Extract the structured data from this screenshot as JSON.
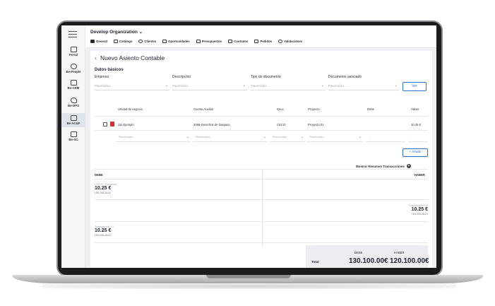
{
  "sidebar": {
    "items": [
      {
        "label": "Portal"
      },
      {
        "label": "Be-People"
      },
      {
        "label": "Be-CRM"
      },
      {
        "label": "Be-OPS"
      },
      {
        "label": "Be-AC&F"
      },
      {
        "label": "Be-SC"
      }
    ]
  },
  "header": {
    "org": "Develop Organization",
    "tabs": [
      {
        "label": "General"
      },
      {
        "label": "Catálogo"
      },
      {
        "label": "Clientes"
      },
      {
        "label": "Oportunidades"
      },
      {
        "label": "Presupuestos"
      },
      {
        "label": "Contratos"
      },
      {
        "label": "Pedidos"
      },
      {
        "label": "Validaciones"
      }
    ]
  },
  "page": {
    "title": "Nuevo Asiento Contable",
    "section": "Datos básicos",
    "fields": {
      "empresa": {
        "label": "Empresa",
        "placeholder": "Placeholder..."
      },
      "descripcion": {
        "label": "Descripción",
        "placeholder": "Placeholder..."
      },
      "tipo": {
        "label": "Tipo de documento",
        "placeholder": "Placeholder..."
      },
      "documento": {
        "label": "Documento asociado",
        "placeholder": "Placeholder..."
      }
    },
    "ver_label": "Ver"
  },
  "table": {
    "headers": [
      "Unidad de negocio",
      "Cuenta Auxiliar",
      "Ceco",
      "Proyecto",
      "Debe",
      "Haber"
    ],
    "row": {
      "unidad": "111 Ejemplo",
      "cuenta": "2058-Derechos de traspaso",
      "ceco": "CECO",
      "proyecto": "Proyecto 01",
      "debe": "",
      "haber": "10.25 €"
    },
    "input_placeholders": {
      "unidad": "Placeholder...",
      "cuenta": "Placeholder...",
      "ceco": "Placeholder...",
      "proyecto": "Placeholder...",
      "debe": "...",
      "haber": "..."
    },
    "add_label": "+ Añadir"
  },
  "summary": {
    "toggle_label": "Mostrar Resumen Transacciones",
    "debe_label": "DEBE",
    "haber_label": "HABER",
    "entries": [
      {
        "sub": "CECO - Proyecto",
        "amount": "10.25 €",
        "account": "UN.205.AUX"
      },
      {
        "sub": "Transacción 02",
        "amount": "10.25 €",
        "account": "UN.205.AUX"
      },
      {
        "sub": "Transacción 01",
        "amount": "10.25 €",
        "account": "UN.205.AUX"
      }
    ]
  },
  "totals": {
    "label": "Total",
    "debe_label": "DEBE",
    "haber_label": "HABER",
    "debe": "130.100.00€",
    "haber": "120.100.00€"
  }
}
